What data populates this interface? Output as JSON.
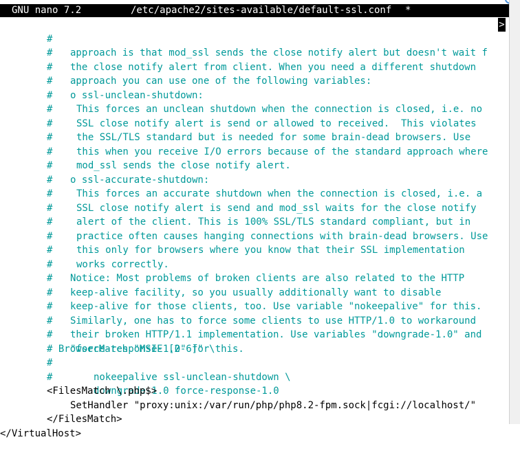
{
  "titlebar": {
    "app": "GNU nano 7.2",
    "filename": "/etc/apache2/sites-available/default-ssl.conf",
    "modified": "*"
  },
  "more_marker": ">",
  "lines": [
    {
      "hash": "#",
      "text": "approach is that mod_ssl sends the close notify alert but doesn't wait f"
    },
    {
      "hash": "#",
      "text": "the close notify alert from client. When you need a different shutdown"
    },
    {
      "hash": "#",
      "text": "approach you can use one of the following variables:"
    },
    {
      "hash": "#",
      "text": "o ssl-unclean-shutdown:"
    },
    {
      "hash": "#",
      "text": "This forces an unclean shutdown when the connection is closed, i.e. no"
    },
    {
      "hash": "#",
      "text": "SSL close notify alert is send or allowed to received.  This violates"
    },
    {
      "hash": "#",
      "text": "the SSL/TLS standard but is needed for some brain-dead browsers. Use"
    },
    {
      "hash": "#",
      "text": "this when you receive I/O errors because of the standard approach where"
    },
    {
      "hash": "#",
      "text": "mod_ssl sends the close notify alert."
    },
    {
      "hash": "#",
      "text": "o ssl-accurate-shutdown:"
    },
    {
      "hash": "#",
      "text": "This forces an accurate shutdown when the connection is closed, i.e. a"
    },
    {
      "hash": "#",
      "text": "SSL close notify alert is send and mod_ssl waits for the close notify"
    },
    {
      "hash": "#",
      "text": "alert of the client. This is 100% SSL/TLS standard compliant, but in"
    },
    {
      "hash": "#",
      "text": "practice often causes hanging connections with brain-dead browsers. Use"
    },
    {
      "hash": "#",
      "text": "this only for browsers where you know that their SSL implementation"
    },
    {
      "hash": "#",
      "text": "works correctly."
    },
    {
      "hash": "#",
      "text": "Notice: Most problems of broken clients are also related to the HTTP"
    },
    {
      "hash": "#",
      "text": "keep-alive facility, so you usually additionally want to disable"
    },
    {
      "hash": "#",
      "text": "keep-alive for those clients, too. Use variable \"nokeepalive\" for this."
    },
    {
      "hash": "#",
      "text": "Similarly, one has to force some clients to use HTTP/1.0 to workaround"
    },
    {
      "hash": "#",
      "text": "their broken HTTP/1.1 implementation. Use variables \"downgrade-1.0\" and"
    },
    {
      "hash": "#",
      "text": "\"force-response-1.0\" for this."
    },
    {
      "text": "# BrowserMatch \"MSIE [2-6]\" \\"
    },
    {
      "hash": "#",
      "text": "nokeepalive ssl-unclean-shutdown \\"
    },
    {
      "hash": "#",
      "text": "downgrade-1.0 force-response-1.0"
    },
    {
      "text": "<FilesMatch \\.php$>"
    },
    {
      "text": "SetHandler \"proxy:unix:/var/run/php/php8.2-fpm.sock|fcgi://localhost/\""
    },
    {
      "text": "</FilesMatch>"
    },
    {
      "text": "</VirtualHost>"
    }
  ]
}
